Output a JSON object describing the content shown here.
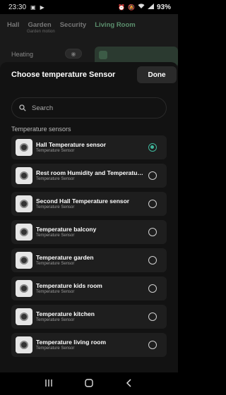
{
  "status_bar": {
    "time": "23:30",
    "battery": "93%",
    "left_icons": [
      "image-icon",
      "play-icon"
    ],
    "right_icons": [
      "alarm-icon",
      "mute-icon",
      "wifi-icon",
      "signal-icon"
    ]
  },
  "background_app": {
    "tabs": [
      "Hall",
      "Garden",
      "Security",
      "Living Room"
    ],
    "active_tab": "Living Room",
    "tab_subtitle": "Garden motion",
    "heating_label": "Heating"
  },
  "sheet": {
    "title": "Choose temperature Sensor",
    "done_label": "Done",
    "search_placeholder": "Search",
    "section_label": "Temperature sensors",
    "sensors": [
      {
        "name": "Hall Temperature sensor",
        "type": "Temperature Sensor",
        "selected": true
      },
      {
        "name": "Rest room Humidity and Temperatur...",
        "type": "Temperature Sensor",
        "selected": false
      },
      {
        "name": "Second Hall Temperature sensor",
        "type": "Temperature Sensor",
        "selected": false
      },
      {
        "name": "Temperature balcony",
        "type": "Temperature Sensor",
        "selected": false
      },
      {
        "name": "Temperature garden",
        "type": "Temperature Sensor",
        "selected": false
      },
      {
        "name": "Temperature kids room",
        "type": "Temperature Sensor",
        "selected": false
      },
      {
        "name": "Temperature kitchen",
        "type": "Temperature Sensor",
        "selected": false
      },
      {
        "name": "Temperature living room",
        "type": "Temperature Sensor",
        "selected": false
      }
    ]
  },
  "nav_bar": {
    "buttons": [
      "recents-button",
      "home-button",
      "back-button"
    ]
  },
  "colors": {
    "accent": "#3fb59a",
    "sheet_bg": "#121212",
    "item_bg": "#1e1e1e"
  }
}
